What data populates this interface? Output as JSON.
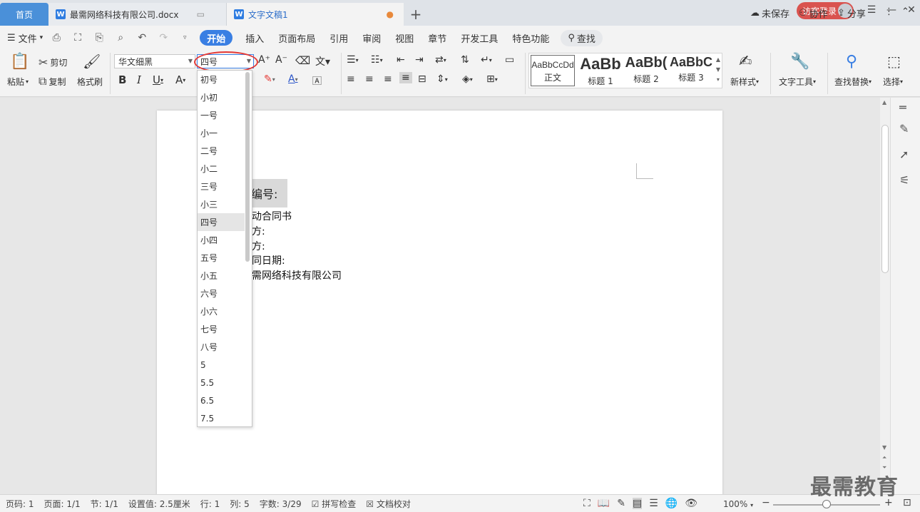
{
  "tabs": {
    "home": "首页",
    "doc1": "最需网络科技有限公司.docx",
    "doc2": "文字文稿1",
    "login": "访客登录"
  },
  "menu": {
    "file": "文件",
    "items": [
      "开始",
      "插入",
      "页面布局",
      "引用",
      "审阅",
      "视图",
      "章节",
      "开发工具",
      "特色功能"
    ],
    "search": "查找",
    "unsaved": "未保存",
    "collab": "协作",
    "share": "分享"
  },
  "ribbon": {
    "paste": "粘贴",
    "cut": "剪切",
    "copy": "复制",
    "format_painter": "格式刷",
    "font_name": "华文细黑",
    "font_size": "四号",
    "new_style": "新样式",
    "text_tools": "文字工具",
    "find_replace": "查找替换",
    "select": "选择",
    "styles": [
      {
        "sample": "AaBbCcDd",
        "name": "正文"
      },
      {
        "sample": "AaBb",
        "name": "标题 1"
      },
      {
        "sample": "AaBb(",
        "name": "标题 2"
      },
      {
        "sample": "AaBbC",
        "name": "标题 3"
      }
    ]
  },
  "font_sizes": [
    "初号",
    "小初",
    "一号",
    "小一",
    "二号",
    "小二",
    "三号",
    "小三",
    "四号",
    "小四",
    "五号",
    "小五",
    "六号",
    "小六",
    "七号",
    "八号",
    "5",
    "5.5",
    "6.5",
    "7.5"
  ],
  "selected_size": "四号",
  "document": {
    "heading": "编号:",
    "lines": [
      "动合同书",
      "方:",
      "方:",
      "同日期:",
      "需网络科技有限公司"
    ]
  },
  "status": {
    "page_num": "页码: 1",
    "pages": "页面: 1/1",
    "section": "节: 1/1",
    "setting": "设置值: 2.5厘米",
    "row": "行: 1",
    "col": "列: 5",
    "words": "字数: 3/29",
    "spell": "拼写检查",
    "proof": "文档校对",
    "zoom": "100%"
  },
  "watermark": "最需教育"
}
